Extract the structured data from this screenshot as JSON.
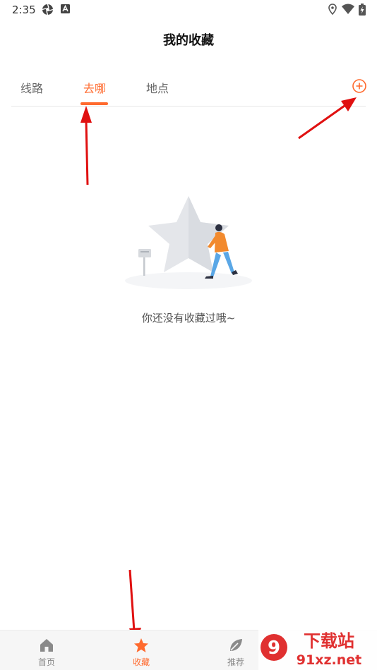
{
  "status_bar": {
    "time": "2:35",
    "left_icons": [
      "aperture-icon",
      "app-a-icon"
    ],
    "right_icons": [
      "location-icon",
      "wifi-icon",
      "battery-charging-icon"
    ]
  },
  "header": {
    "title": "我的收藏"
  },
  "tabs": {
    "items": [
      {
        "label": "线路",
        "active": false
      },
      {
        "label": "去哪",
        "active": true
      },
      {
        "label": "地点",
        "active": false
      }
    ],
    "add_icon": "plus-circle-icon"
  },
  "empty_state": {
    "illustration": "star-person-illustration",
    "message": "你还没有收藏过哦~"
  },
  "bottom_nav": {
    "items": [
      {
        "label": "首页",
        "icon": "home-icon",
        "active": false
      },
      {
        "label": "收藏",
        "icon": "star-icon",
        "active": true
      },
      {
        "label": "推荐",
        "icon": "leaf-icon",
        "active": false
      }
    ]
  },
  "watermark": {
    "logo_text": "9下载站",
    "url_text": "91xz.net"
  },
  "colors": {
    "accent": "#ff6a2e",
    "annotation_arrow": "#e01010"
  }
}
